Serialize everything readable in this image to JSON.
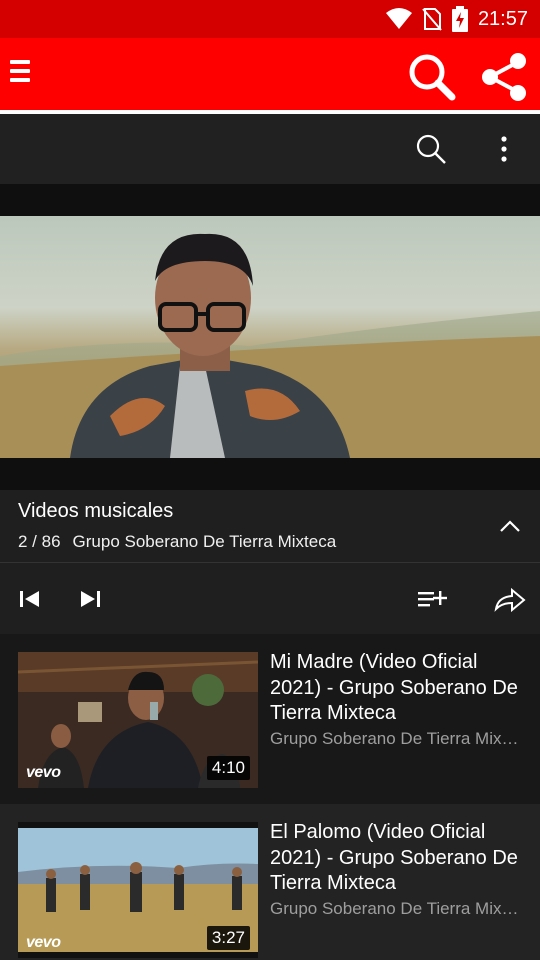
{
  "status_bar": {
    "time": "21:57",
    "icons": [
      "wifi-icon",
      "no-sim-icon",
      "battery-charging-icon"
    ]
  },
  "app_bar": {
    "icons": [
      "menu-icon",
      "search-icon",
      "share-icon"
    ],
    "color": "#ff0000"
  },
  "player_toolbar": {
    "icons": [
      "search-icon",
      "more-vert-icon"
    ]
  },
  "playlist": {
    "title": "Videos musicales",
    "position": "2 / 86",
    "channel": "Grupo Soberano De Tierra Mixteca"
  },
  "controls": {
    "icons": [
      "skip-previous-icon",
      "skip-next-icon",
      "add-to-playlist-icon",
      "share-arrow-icon"
    ]
  },
  "videos": [
    {
      "title": "Mi Madre (Video Oficial 2021) - Grupo Soberano De Tierra Mixteca",
      "channel": "Grupo Soberano De Tierra Mixteca",
      "duration": "4:10",
      "badge": "vevo"
    },
    {
      "title": "El Palomo (Video Oficial 2021) - Grupo Soberano De Tierra Mixteca",
      "channel": "Grupo Soberano De Tierra Mixteca",
      "duration": "3:27",
      "badge": "vevo"
    }
  ]
}
